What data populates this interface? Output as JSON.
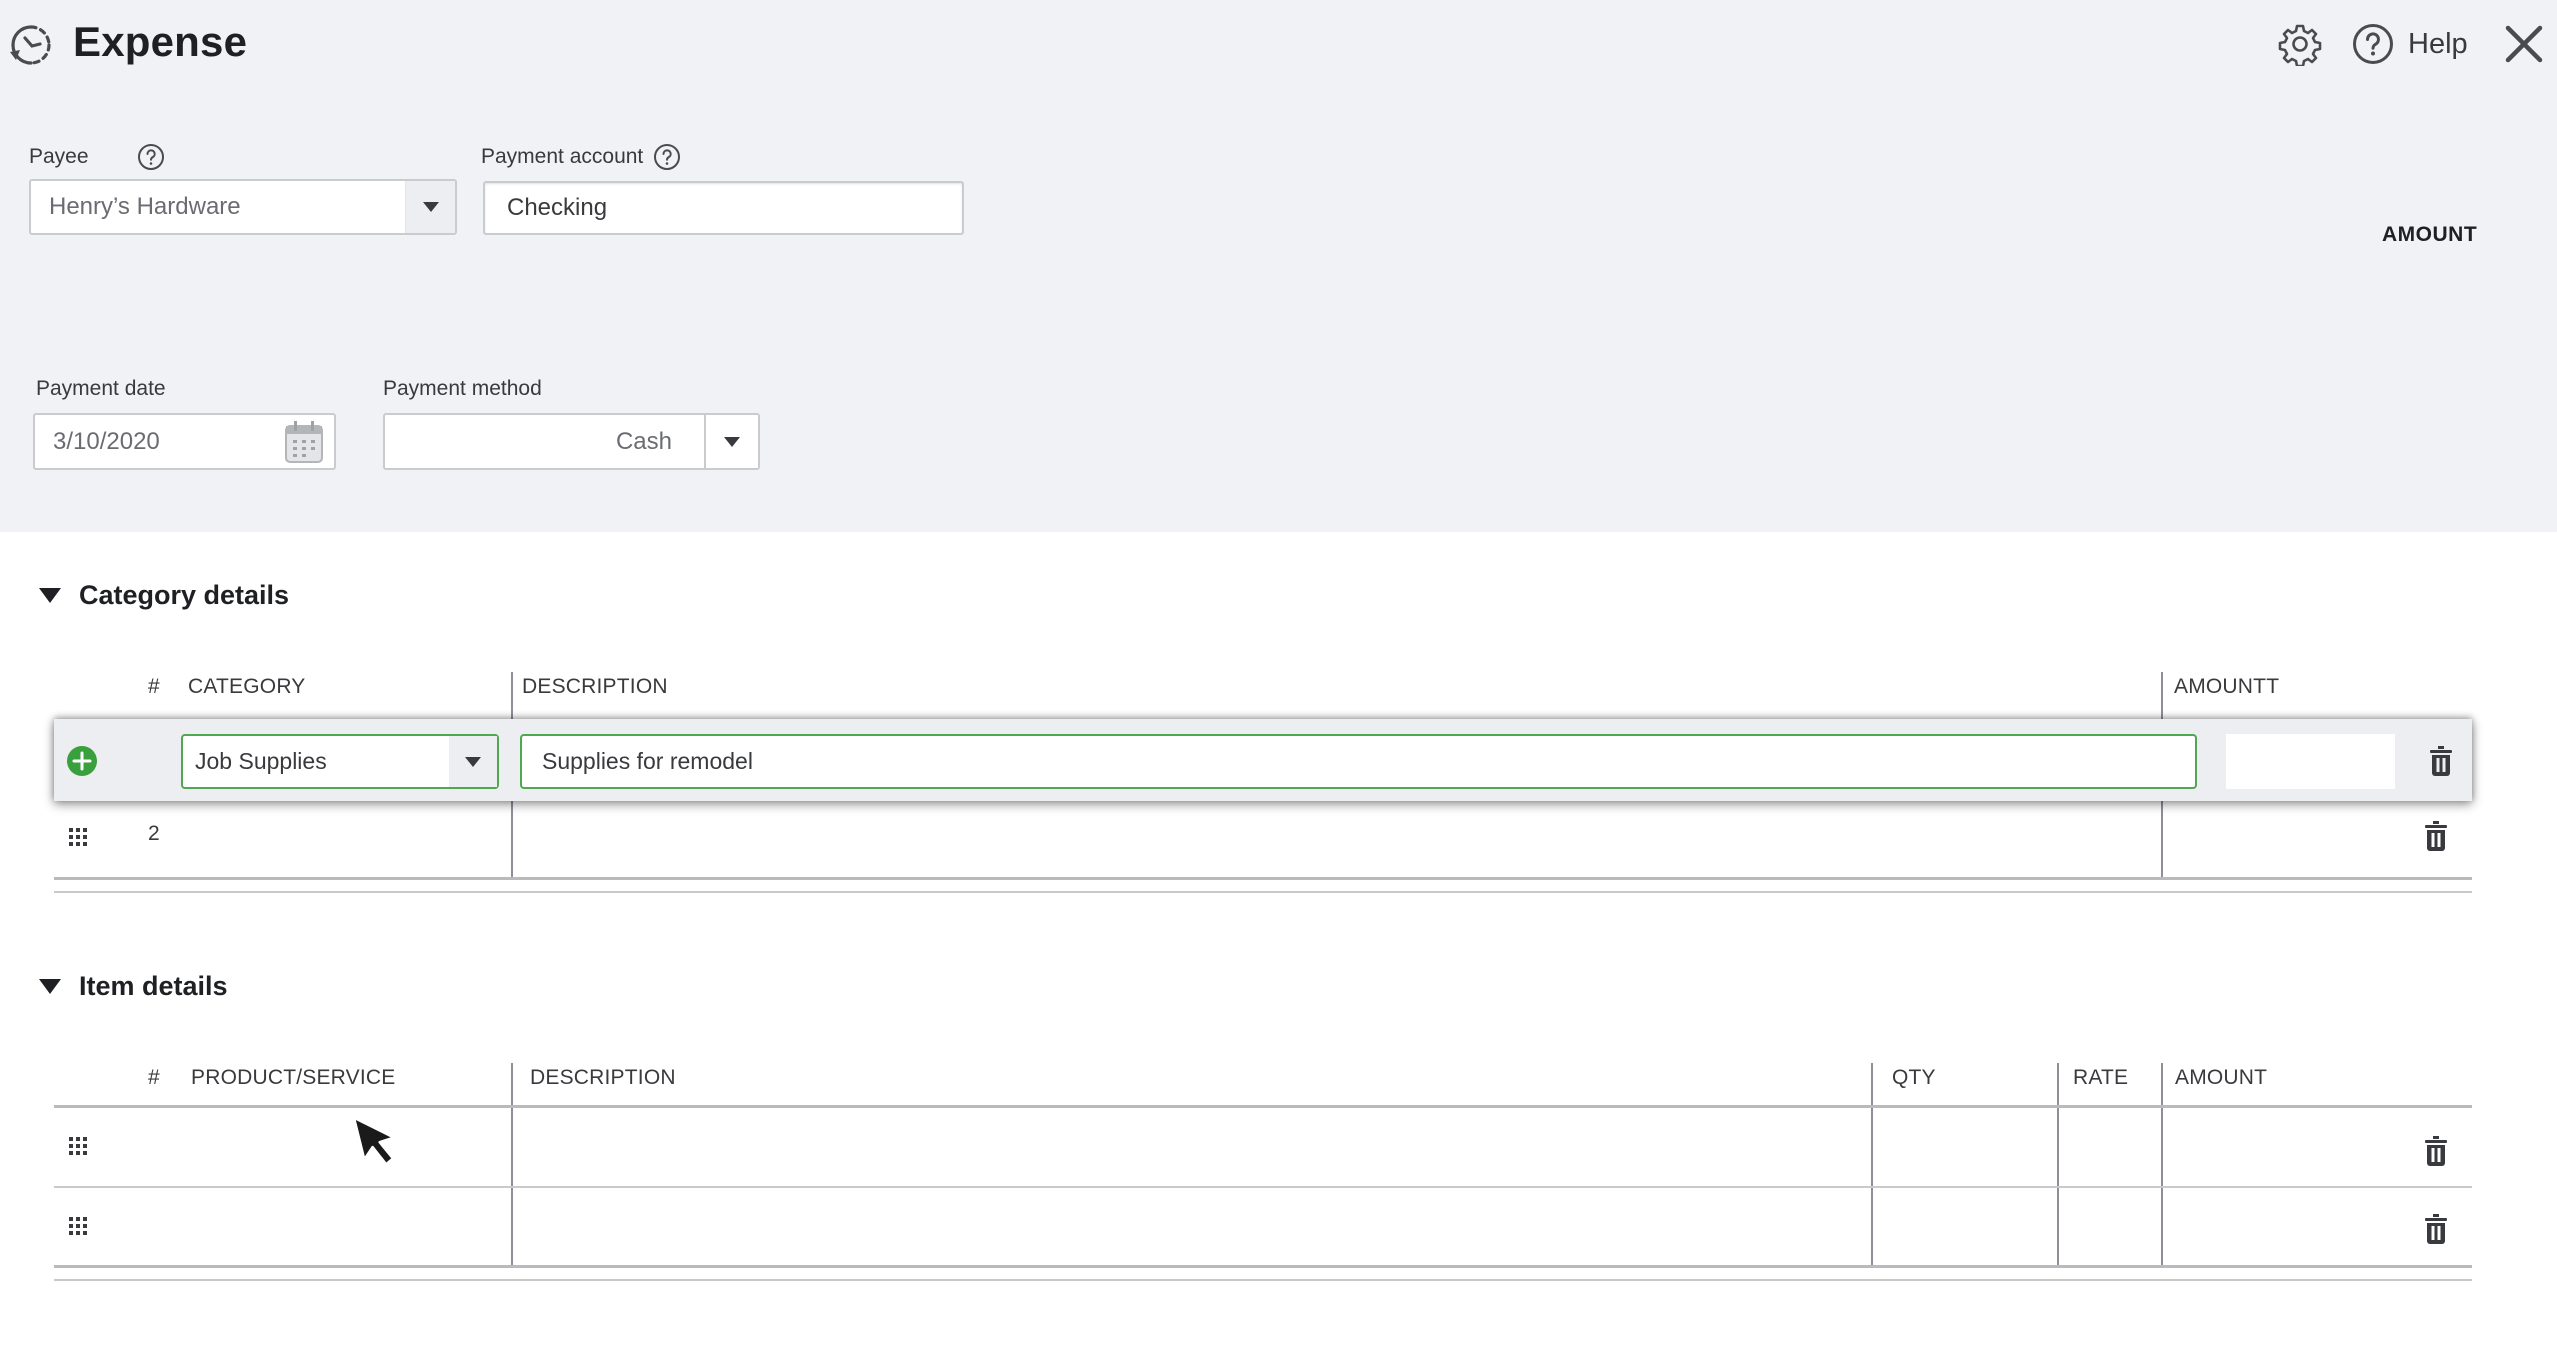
{
  "header": {
    "title": "Expense",
    "help_label": "Help",
    "icons": [
      "history-icon",
      "gear-icon",
      "help-icon",
      "close-icon"
    ]
  },
  "form": {
    "payee": {
      "label": "Payee",
      "value": "Henry’s Hardware"
    },
    "payment_account": {
      "label": "Payment account",
      "value": "Checking"
    },
    "amount_label": "AMOUNT",
    "payment_date": {
      "label": "Payment date",
      "value": "3/10/2020"
    },
    "payment_method": {
      "label": "Payment method",
      "value": "Cash"
    }
  },
  "category_details": {
    "title": "Category details",
    "columns": [
      "#",
      "CATEGORY",
      "DESCRIPTION",
      "AMOUNTT"
    ],
    "rows": [
      {
        "num": "",
        "category": "Job Supplies",
        "description": "Supplies for remodel",
        "amount": ""
      },
      {
        "num": "2",
        "category": "",
        "description": "",
        "amount": ""
      }
    ]
  },
  "item_details": {
    "title": "Item details",
    "columns": [
      "#",
      "PRODUCT/SERVICE",
      "DESCRIPTION",
      "QTY",
      "RATE",
      "AMOUNT"
    ],
    "rows": [
      {
        "num": "",
        "product": "",
        "description": "",
        "qty": "",
        "rate": "",
        "amount": ""
      },
      {
        "num": "",
        "product": "",
        "description": "",
        "qty": "",
        "rate": "",
        "amount": ""
      }
    ]
  },
  "colors": {
    "header_bg": "#f1f2f5",
    "active_field_border": "#4ea84f",
    "add_icon": "#3aa03d"
  }
}
